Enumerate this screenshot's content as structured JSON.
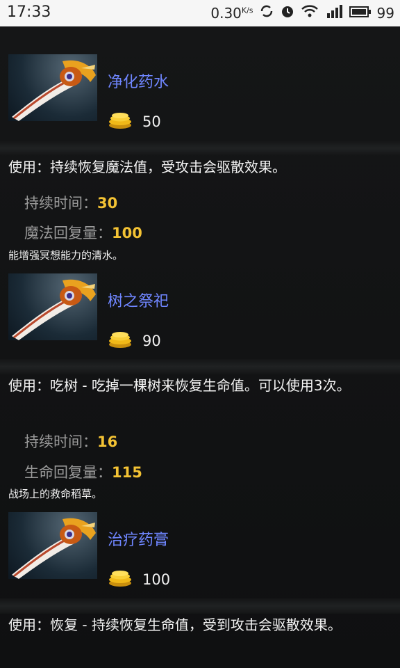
{
  "status": {
    "time": "17:33",
    "speed_value": "0.30",
    "speed_unit": "K/s",
    "battery": "99"
  },
  "items": [
    {
      "name": "净化药水",
      "cost": "50",
      "use_text": "使用：持续恢复魔法值，受攻击会驱散效果。",
      "stats": [
        {
          "label": "持续时间：",
          "value": "30"
        },
        {
          "label": "魔法回复量：",
          "value": "100"
        }
      ],
      "lore": "能增强冥想能力的清水。"
    },
    {
      "name": "树之祭祀",
      "cost": "90",
      "use_text": "使用：吃树 - 吃掉一棵树来恢复生命值。可以使用3次。",
      "stats": [
        {
          "label": "持续时间：",
          "value": "16"
        },
        {
          "label": "生命回复量：",
          "value": "115"
        }
      ],
      "lore": "战场上的救命稻草。"
    },
    {
      "name": "治疗药膏",
      "cost": "100",
      "use_text": "使用：恢复 - 持续恢复生命值，受到攻击会驱散效果。",
      "stats": [],
      "lore": ""
    }
  ],
  "icons": [
    "sword-item-icon",
    "gold-coins-icon",
    "sync-icon",
    "alarm-icon",
    "wifi-icon",
    "signal-icon",
    "battery-icon"
  ]
}
